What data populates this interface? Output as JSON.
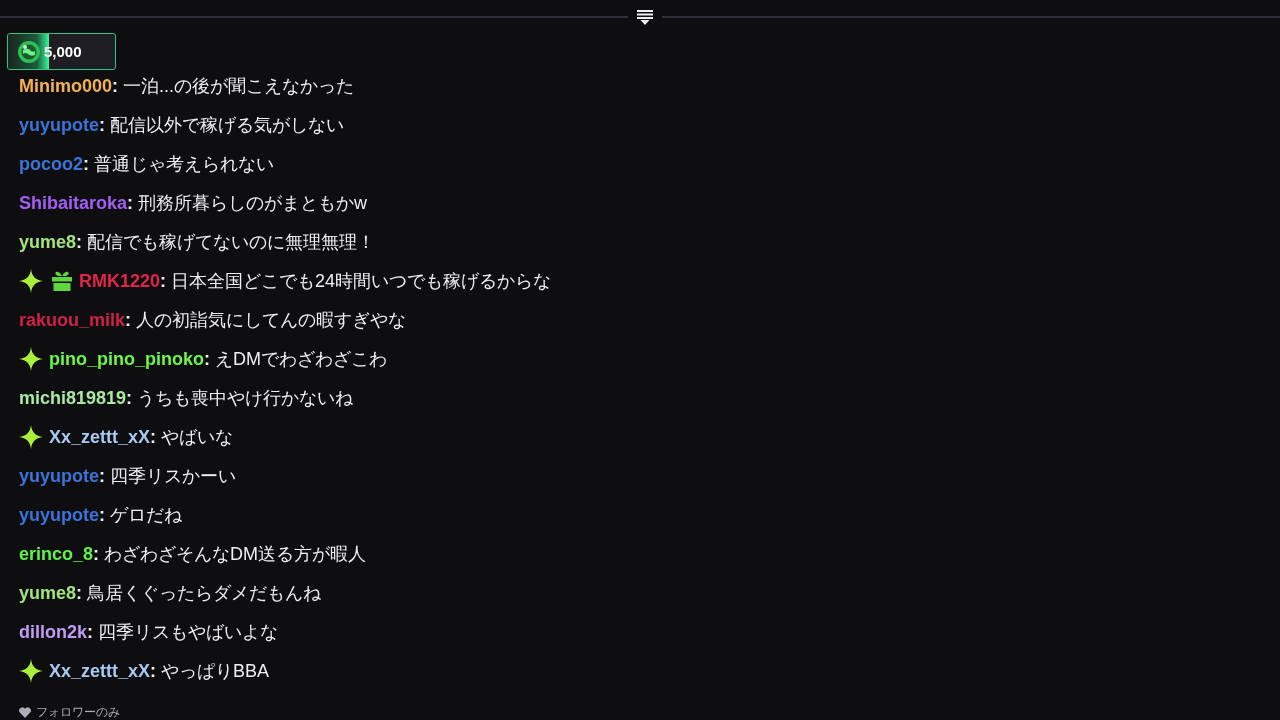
{
  "points_badge": {
    "amount": "5,000",
    "level": 0.38
  },
  "messages": [
    {
      "user": "Minimo000",
      "color": "#f2b155",
      "separator": ":",
      "text": "一泊...の後が聞こえなかった"
    },
    {
      "user": "yuyupote",
      "color": "#3a74d9",
      "separator": ":",
      "text": "配信以外で稼げる気がしない"
    },
    {
      "user": "pocoo2",
      "color": "#3a74d9",
      "separator": ":",
      "text": "普通じゃ考えられない"
    },
    {
      "user": "Shibaitaroka",
      "color": "#a25ef5",
      "separator": ":",
      "text": "刑務所暮らしのがまともかw"
    },
    {
      "user": "yume8",
      "color": "#a3e37d",
      "separator": ":",
      "text": "配信でも稼げてないのに無理無理！"
    },
    {
      "user": "RMK1220",
      "color": "#e0254a",
      "separator": ":",
      "text": "日本全国どこでも24時間いつでも稼げるからな",
      "badges": [
        {
          "kind": "sparkle"
        },
        {
          "kind": "gift"
        }
      ]
    },
    {
      "user": "rakuou_milk",
      "color": "#cf2147",
      "separator": ":",
      "text": "人の初詣気にしてんの暇すぎやな"
    },
    {
      "user": "pino_pino_pinoko",
      "color": "#6df54a",
      "separator": ":",
      "text": "えDMでわざわざこわ",
      "badges": [
        {
          "kind": "sparkle"
        }
      ]
    },
    {
      "user": "michi819819",
      "color": "#abe9a3",
      "separator": ":",
      "text": "うちも喪中やけ行かないね"
    },
    {
      "user": "Xx_zettt_xX",
      "color": "#a7c9f2",
      "separator": ":",
      "text": "やばいな",
      "badges": [
        {
          "kind": "sparkle"
        }
      ]
    },
    {
      "user": "yuyupote",
      "color": "#3a74d9",
      "separator": ":",
      "text": "四季リスかーい"
    },
    {
      "user": "yuyupote",
      "color": "#3a74d9",
      "separator": ":",
      "text": "ゲロだね"
    },
    {
      "user": "erinco_8",
      "color": "#5ff24c",
      "separator": ":",
      "text": "わざわざそんなDM送る方が暇人"
    },
    {
      "user": "yume8",
      "color": "#a3e37d",
      "separator": ":",
      "text": "鳥居くぐったらダメだもんね"
    },
    {
      "user": "dillon2k",
      "color": "#c29bf2",
      "separator": ":",
      "text": "四季リスもやばいよな"
    },
    {
      "user": "Xx_zettt_xX",
      "color": "#a7c9f2",
      "separator": ":",
      "text": "やっぱりBBA",
      "badges": [
        {
          "kind": "sparkle"
        }
      ]
    }
  ],
  "footer": {
    "label": "フォロワーのみ"
  }
}
